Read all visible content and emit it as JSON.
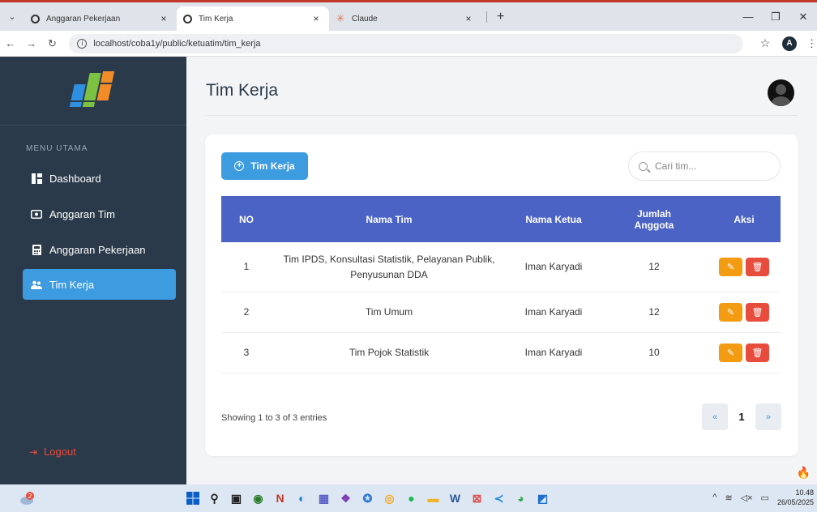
{
  "browser": {
    "tabs": [
      {
        "title": "Anggaran Pekerjaan",
        "icon": "globe-icon",
        "active": false
      },
      {
        "title": "Tim Kerja",
        "icon": "globe-icon",
        "active": true
      },
      {
        "title": "Claude",
        "icon": "claude-icon",
        "active": false
      }
    ],
    "url": "localhost/coba1y/public/ketuatim/tim_kerja",
    "profile_initial": "A"
  },
  "sidebar": {
    "menu_heading": "MENU UTAMA",
    "items": [
      {
        "label": "Dashboard",
        "icon": "dashboard-icon",
        "active": false
      },
      {
        "label": "Anggaran Tim",
        "icon": "wallet-icon",
        "active": false
      },
      {
        "label": "Anggaran Pekerjaan",
        "icon": "calculator-icon",
        "active": false
      },
      {
        "label": "Tim Kerja",
        "icon": "users-icon",
        "active": true
      }
    ],
    "logout_label": "Logout"
  },
  "main": {
    "page_title": "Tim Kerja",
    "add_button_label": "Tim Kerja",
    "search": {
      "placeholder": "Cari tim...",
      "value": ""
    },
    "table": {
      "headers": {
        "no": "NO",
        "nama_tim": "Nama Tim",
        "nama_ketua": "Nama Ketua",
        "jumlah_line1": "Jumlah",
        "jumlah_line2": "Anggota",
        "aksi": "Aksi"
      },
      "rows": [
        {
          "no": "1",
          "tim_line1": "Tim IPDS, Konsultasi Statistik, Pelayanan Publik,",
          "tim_line2": "Penyusunan DDA",
          "ketua": "Iman Karyadi",
          "jumlah": "12"
        },
        {
          "no": "2",
          "tim_line1": "Tim Umum",
          "tim_line2": "",
          "ketua": "Iman Karyadi",
          "jumlah": "12"
        },
        {
          "no": "3",
          "tim_line1": "Tim Pojok Statistik",
          "tim_line2": "",
          "ketua": "Iman Karyadi",
          "jumlah": "10"
        }
      ]
    },
    "entries_info": "Showing 1 to 3 of 3 entries",
    "pagination": {
      "prev": "«",
      "current": "1",
      "next": "»"
    }
  },
  "taskbar": {
    "notification_count": "2",
    "time": "10.48",
    "date": "26/05/2025"
  },
  "colors": {
    "sidebar_bg": "#2b3a4a",
    "accent": "#3d9be0",
    "table_header": "#4a63c4",
    "edit": "#f39c12",
    "delete": "#e74c3c"
  }
}
